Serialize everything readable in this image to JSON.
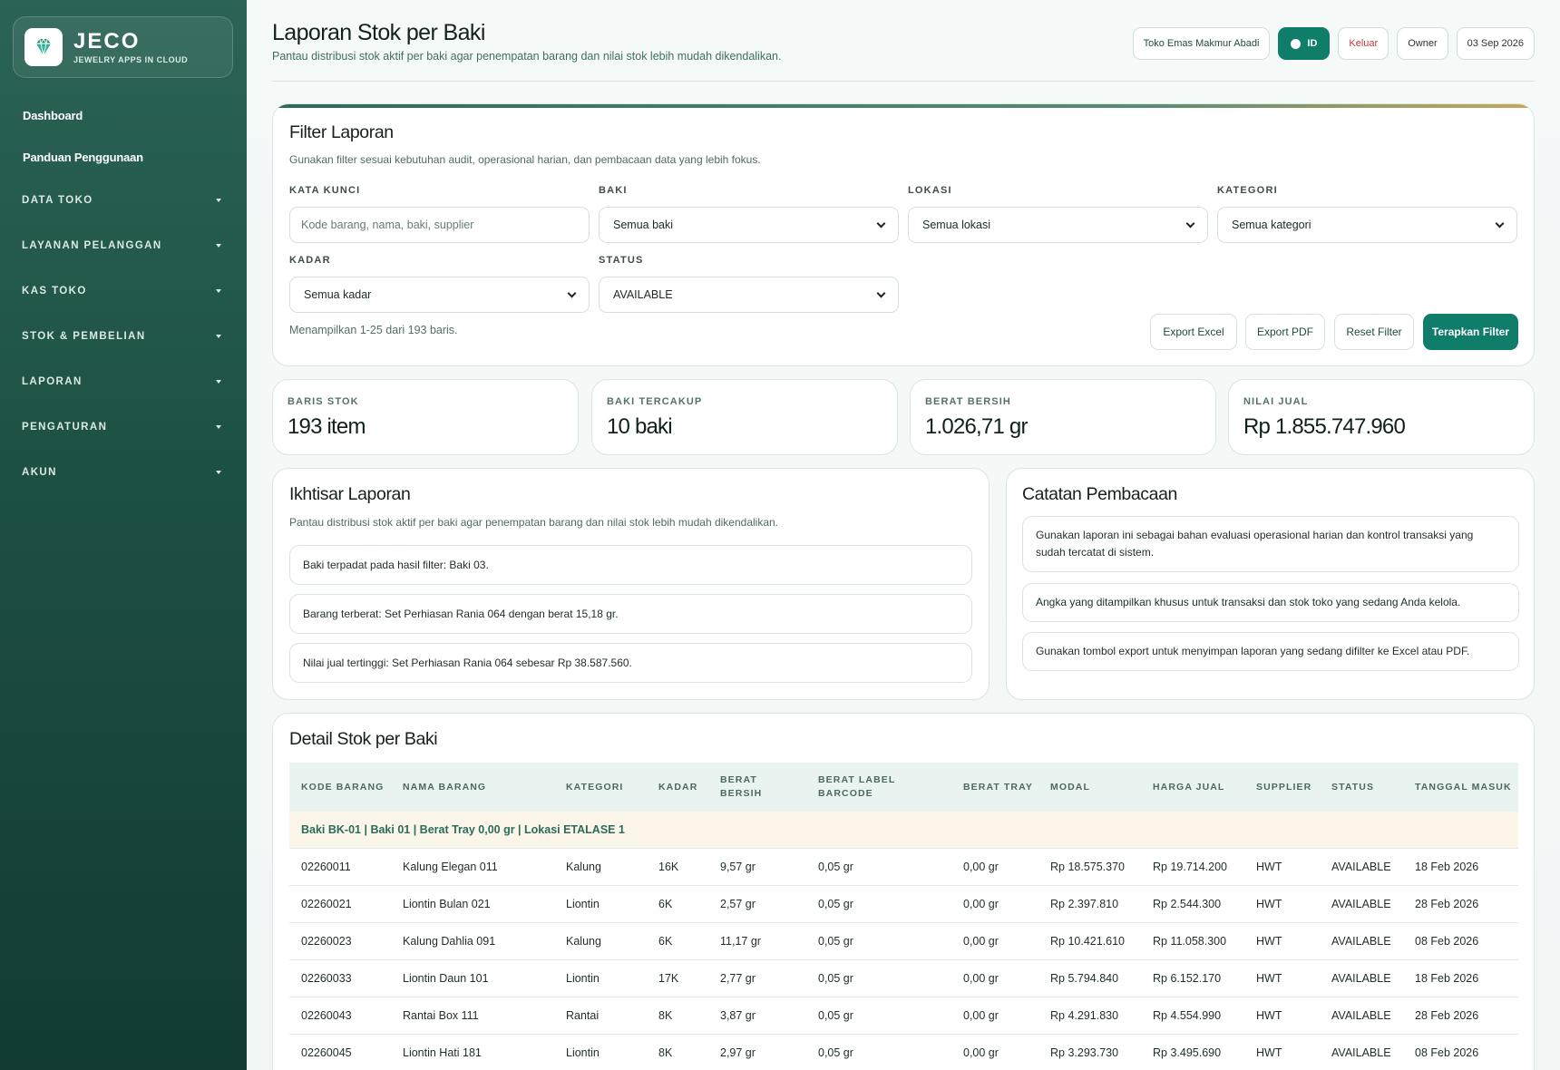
{
  "brand": {
    "name": "JECO",
    "tagline": "JEWELRY APPS IN CLOUD"
  },
  "nav": {
    "links": [
      "Dashboard",
      "Panduan Penggunaan"
    ],
    "groups": [
      "DATA TOKO",
      "LAYANAN PELANGGAN",
      "KAS TOKO",
      "STOK & PEMBELIAN",
      "LAPORAN",
      "PENGATURAN",
      "AKUN"
    ]
  },
  "header": {
    "title": "Laporan Stok per Baki",
    "subtitle": "Pantau distribusi stok aktif per baki agar penempatan barang dan nilai stok lebih mudah dikendalikan.",
    "store": "Toko Emas Makmur Abadi",
    "lang": "ID",
    "logout": "Keluar",
    "role": "Owner",
    "date": "03 Sep 2026"
  },
  "filter": {
    "title": "Filter Laporan",
    "desc": "Gunakan filter sesuai kebutuhan audit, operasional harian, dan pembacaan data yang lebih fokus.",
    "keyword_label": "KATA KUNCI",
    "keyword_placeholder": "Kode barang, nama, baki, supplier",
    "baki_label": "BAKI",
    "baki_value": "Semua baki",
    "lokasi_label": "LOKASI",
    "lokasi_value": "Semua lokasi",
    "kategori_label": "KATEGORI",
    "kategori_value": "Semua kategori",
    "kadar_label": "KADAR",
    "kadar_value": "Semua kadar",
    "status_label": "STATUS",
    "status_value": "AVAILABLE",
    "count_text": "Menampilkan 1-25 dari 193 baris.",
    "export_excel": "Export Excel",
    "export_pdf": "Export PDF",
    "reset": "Reset Filter",
    "apply": "Terapkan Filter"
  },
  "stats": [
    {
      "label": "BARIS STOK",
      "value": "193 item"
    },
    {
      "label": "BAKI TERCAKUP",
      "value": "10 baki"
    },
    {
      "label": "BERAT BERSIH",
      "value": "1.026,71 gr"
    },
    {
      "label": "NILAI JUAL",
      "value": "Rp 1.855.747.960"
    }
  ],
  "summary": {
    "title": "Ikhtisar Laporan",
    "desc": "Pantau distribusi stok aktif per baki agar penempatan barang dan nilai stok lebih mudah dikendalikan.",
    "items": [
      "Baki terpadat pada hasil filter: Baki 03.",
      "Barang terberat: Set Perhiasan Rania 064 dengan berat 15,18 gr.",
      "Nilai jual tertinggi: Set Perhiasan Rania 064 sebesar Rp 38.587.560."
    ]
  },
  "notes": {
    "title": "Catatan Pembacaan",
    "items": [
      "Gunakan laporan ini sebagai bahan evaluasi operasional harian dan kontrol transaksi yang sudah tercatat di sistem.",
      "Angka yang ditampilkan khusus untuk transaksi dan stok toko yang sedang Anda kelola.",
      "Gunakan tombol export untuk menyimpan laporan yang sedang difilter ke Excel atau PDF."
    ]
  },
  "detail": {
    "title": "Detail Stok per Baki",
    "columns": [
      "KODE BARANG",
      "NAMA BARANG",
      "KATEGORI",
      "KADAR",
      "BERAT BERSIH",
      "BERAT LABEL BARCODE",
      "BERAT TRAY",
      "MODAL",
      "HARGA JUAL",
      "SUPPLIER",
      "STATUS",
      "TANGGAL MASUK"
    ],
    "group_label": "Baki BK-01 | Baki 01 | Berat Tray 0,00 gr | Lokasi ETALASE 1",
    "rows": [
      [
        "02260011",
        "Kalung Elegan 011",
        "Kalung",
        "16K",
        "9,57 gr",
        "0,05 gr",
        "0,00 gr",
        "Rp 18.575.370",
        "Rp 19.714.200",
        "HWT",
        "AVAILABLE",
        "18 Feb 2026"
      ],
      [
        "02260021",
        "Liontin Bulan 021",
        "Liontin",
        "6K",
        "2,57 gr",
        "0,05 gr",
        "0,00 gr",
        "Rp 2.397.810",
        "Rp 2.544.300",
        "HWT",
        "AVAILABLE",
        "28 Feb 2026"
      ],
      [
        "02260023",
        "Kalung Dahlia 091",
        "Kalung",
        "6K",
        "11,17 gr",
        "0,05 gr",
        "0,00 gr",
        "Rp 10.421.610",
        "Rp 11.058.300",
        "HWT",
        "AVAILABLE",
        "08 Feb 2026"
      ],
      [
        "02260033",
        "Liontin Daun 101",
        "Liontin",
        "17K",
        "2,77 gr",
        "0,05 gr",
        "0,00 gr",
        "Rp 5.794.840",
        "Rp 6.152.170",
        "HWT",
        "AVAILABLE",
        "18 Feb 2026"
      ],
      [
        "02260043",
        "Rantai Box 111",
        "Rantai",
        "8K",
        "3,87 gr",
        "0,05 gr",
        "0,00 gr",
        "Rp 4.291.830",
        "Rp 4.554.990",
        "HWT",
        "AVAILABLE",
        "28 Feb 2026"
      ],
      [
        "02260045",
        "Liontin Hati 181",
        "Liontin",
        "8K",
        "2,97 gr",
        "0,05 gr",
        "0,00 gr",
        "Rp 3.293.730",
        "Rp 3.495.690",
        "HWT",
        "AVAILABLE",
        "08 Feb 2026"
      ]
    ]
  }
}
